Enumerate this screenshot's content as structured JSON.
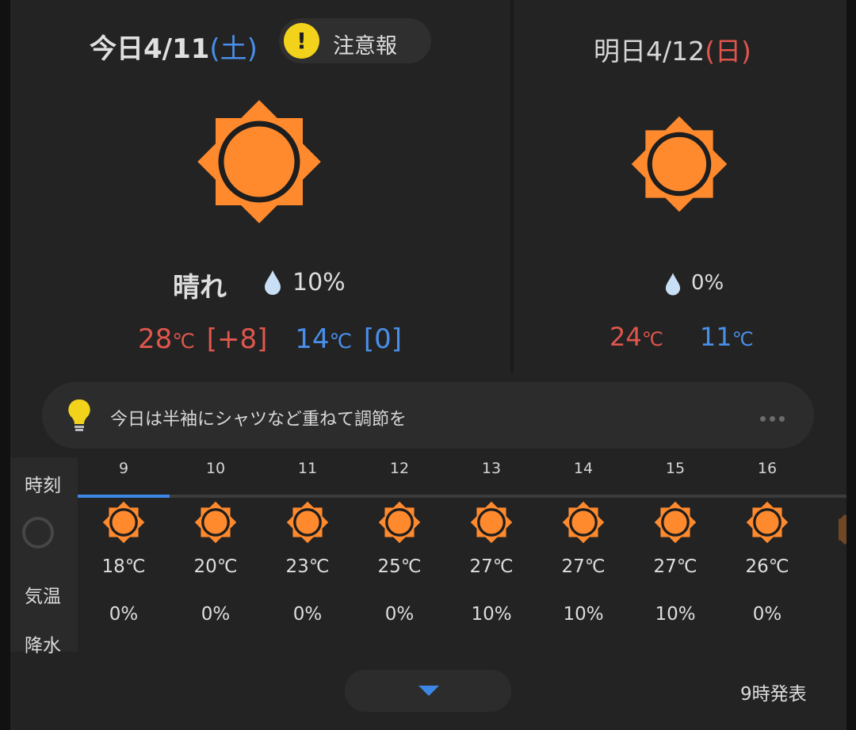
{
  "today": {
    "label": "今日4/11",
    "weekday": "(土)",
    "warning_label": "注意報",
    "weather": "晴れ",
    "pop": "10%",
    "high": "28",
    "high_diff": "[+8]",
    "low": "14",
    "low_diff": "[0]",
    "unit": "℃"
  },
  "tomorrow": {
    "label": "明日4/12",
    "weekday": "(日)",
    "pop": "0%",
    "high": "24",
    "low": "11",
    "unit": "℃"
  },
  "advice": {
    "text": "今日は半袖にシャツなど重ねて調節を"
  },
  "hourly": {
    "labels": {
      "time": "時刻",
      "temp": "気温",
      "precip": "降水"
    },
    "hours": [
      {
        "hour": "9",
        "temp": "18℃",
        "pop": "0%"
      },
      {
        "hour": "10",
        "temp": "20℃",
        "pop": "0%"
      },
      {
        "hour": "11",
        "temp": "23℃",
        "pop": "0%"
      },
      {
        "hour": "12",
        "temp": "25℃",
        "pop": "0%"
      },
      {
        "hour": "13",
        "temp": "27℃",
        "pop": "10%"
      },
      {
        "hour": "14",
        "temp": "27℃",
        "pop": "10%"
      },
      {
        "hour": "15",
        "temp": "27℃",
        "pop": "10%"
      },
      {
        "hour": "16",
        "temp": "26℃",
        "pop": "0%"
      }
    ]
  },
  "footer": {
    "issued": "9時発表"
  },
  "colors": {
    "sun": "#ff8a2e",
    "sun_ring": "#1e1e1e",
    "high": "#e0564d",
    "low": "#4a8fea",
    "warning": "#f3d21c",
    "drop": "#c8dff5"
  },
  "icons": {
    "weather": "sunny-icon",
    "warning": "exclamation-icon",
    "advice": "lightbulb-icon",
    "more": "more-horizontal-icon",
    "expand": "chevron-down-icon"
  }
}
